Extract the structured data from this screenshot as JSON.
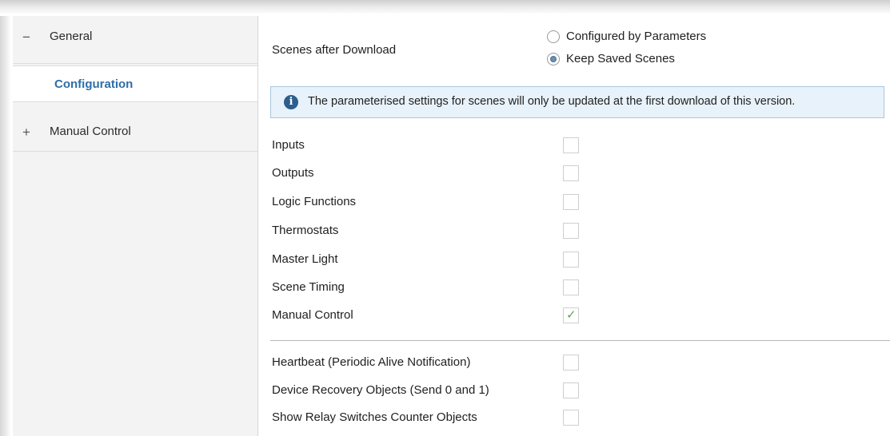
{
  "sidebar": {
    "items": [
      {
        "sign": "−",
        "label": "General"
      },
      {
        "sign": "",
        "label": "Configuration"
      },
      {
        "sign": "+",
        "label": "Manual Control"
      }
    ]
  },
  "main": {
    "scenes": {
      "label": "Scenes after Download",
      "options": [
        "Configured by Parameters",
        "Keep Saved Scenes"
      ],
      "selected": "Keep Saved Scenes"
    },
    "info": {
      "icon": "info-icon",
      "glyph": "i",
      "text": "The parameterised settings for scenes will only be updated at the first download of this version."
    },
    "options": [
      {
        "label": "Inputs",
        "checked": false
      },
      {
        "label": "Outputs",
        "checked": false
      },
      {
        "label": "Logic Functions",
        "checked": false
      },
      {
        "label": "Thermostats",
        "checked": false
      },
      {
        "label": "Master Light",
        "checked": false
      },
      {
        "label": "Scene Timing",
        "checked": false
      },
      {
        "label": "Manual Control",
        "checked": true
      }
    ],
    "extra_options": [
      {
        "label": "Heartbeat (Periodic Alive Notification)",
        "checked": false
      },
      {
        "label": "Device Recovery Objects (Send 0 and 1)",
        "checked": false
      },
      {
        "label": "Show Relay Switches Counter Objects",
        "checked": false
      }
    ]
  },
  "colors": {
    "accent": "#2f6ea7",
    "check": "#62a35c",
    "info_bg": "#e8f2fa",
    "info_border": "#a7c6df"
  }
}
